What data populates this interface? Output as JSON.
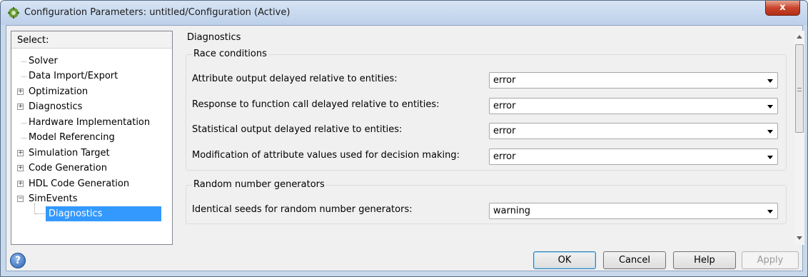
{
  "window": {
    "title": "Configuration Parameters: untitled/Configuration (Active)",
    "close_label": "x"
  },
  "tree": {
    "header": "Select:",
    "items": [
      {
        "label": "Solver",
        "expandable": false
      },
      {
        "label": "Data Import/Export",
        "expandable": false
      },
      {
        "label": "Optimization",
        "expandable": true,
        "state": "+"
      },
      {
        "label": "Diagnostics",
        "expandable": true,
        "state": "+"
      },
      {
        "label": "Hardware Implementation",
        "expandable": false
      },
      {
        "label": "Model Referencing",
        "expandable": false
      },
      {
        "label": "Simulation Target",
        "expandable": true,
        "state": "+"
      },
      {
        "label": "Code Generation",
        "expandable": true,
        "state": "+"
      },
      {
        "label": "HDL Code Generation",
        "expandable": true,
        "state": "+"
      },
      {
        "label": "SimEvents",
        "expandable": true,
        "state": "−"
      },
      {
        "label": "Diagnostics",
        "expandable": false,
        "selected": true
      }
    ]
  },
  "pane": {
    "title": "Diagnostics",
    "race": {
      "title": "Race conditions",
      "rows": [
        {
          "label": "Attribute output delayed relative to entities:",
          "value": "error"
        },
        {
          "label": "Response to function call delayed relative to entities:",
          "value": "error"
        },
        {
          "label": "Statistical output delayed relative to entities:",
          "value": "error"
        },
        {
          "label": "Modification of attribute values used for decision making:",
          "value": "error"
        }
      ]
    },
    "random": {
      "title": "Random number generators",
      "rows": [
        {
          "label": "Identical seeds for random number generators:",
          "value": "warning"
        }
      ]
    }
  },
  "buttons": {
    "help_icon": "?",
    "ok": "OK",
    "cancel": "Cancel",
    "help": "Help",
    "apply": "Apply"
  }
}
